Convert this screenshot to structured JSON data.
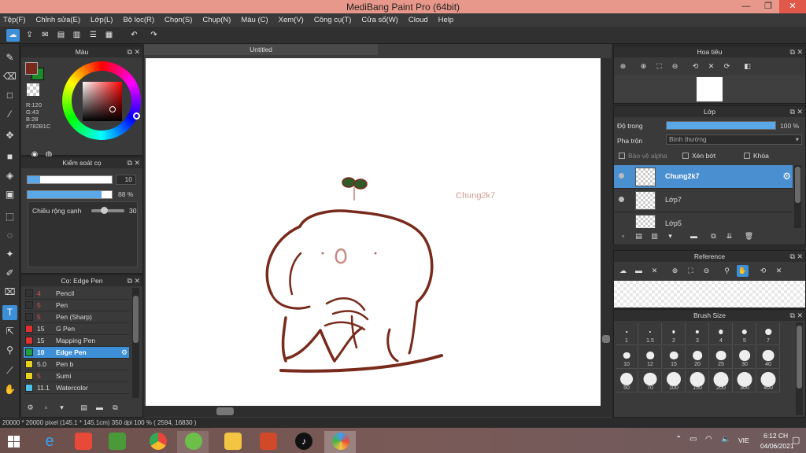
{
  "window": {
    "title": "MediBang Paint Pro (64bit)"
  },
  "menu": [
    "Tệp(F)",
    "Chỉnh sửa(E)",
    "Lớp(L)",
    "Bộ lọc(R)",
    "Chọn(S)",
    "Chụp(N)",
    "Màu (C)",
    "Xem(V)",
    "Công cụ(T)",
    "Cửa sổ(W)",
    "Cloud",
    "Help"
  ],
  "color_panel": {
    "title": "Màu",
    "r": "R:120",
    "g": "G:43",
    "b": "B:28",
    "hex": "#782B1C",
    "main_color": "#782b1c",
    "sub_color": "#1c8a2a"
  },
  "brush_control": {
    "title": "Kiểm soát cọ",
    "size_value": "10",
    "size_fraction": 0.15,
    "opacity_value": "88 %",
    "opacity_fraction": 0.88,
    "width_label": "Chiều rộng cạnh",
    "width_value": "30"
  },
  "brush_list": {
    "title": "Cọ: Edge Pen",
    "items": [
      {
        "size": "4",
        "name": "Pencil",
        "color": "#333333",
        "size_color": "#e05050"
      },
      {
        "size": "5",
        "name": "Pen",
        "color": "#333333",
        "size_color": "#e05050"
      },
      {
        "size": "5",
        "name": "Pen (Sharp)",
        "color": "#333333",
        "size_color": "#e05050"
      },
      {
        "size": "15",
        "name": "G Pen",
        "color": "#e03030",
        "size_color": "#dddddd"
      },
      {
        "size": "15",
        "name": "Mapping Pen",
        "color": "#e03030",
        "size_color": "#dddddd"
      },
      {
        "size": "10",
        "name": "Edge Pen",
        "color": "#20a040",
        "size_color": "#ffffff",
        "selected": true
      },
      {
        "size": "5.0",
        "name": "Pen b",
        "color": "#e8d020",
        "size_color": "#dddddd"
      },
      {
        "size": "5",
        "name": "Sumi",
        "color": "#e8d020",
        "size_color": "#e05050"
      },
      {
        "size": "11.1",
        "name": "Watercolor",
        "color": "#50c0e8",
        "size_color": "#dddddd"
      }
    ]
  },
  "document": {
    "tab_title": "Untitled",
    "signature": "Chung2k7"
  },
  "status": {
    "text": "20000 * 20000 pixel  (145.1 * 145.1cm)  350 dpi  100 %  ( 2594, 16830 )"
  },
  "navigator": {
    "title": "Hoa tiêu"
  },
  "layer_panel": {
    "title": "Lớp",
    "opacity_label": "Độ trong",
    "opacity_value": "100 %",
    "opacity_fraction": 1.0,
    "blend_label": "Pha trộn",
    "blend_value": "Bình thường",
    "protect_alpha": "Bảo vệ alpha",
    "clipping": "Xén bớt",
    "lock": "Khóa",
    "layers": [
      {
        "name": "Chung2k7",
        "selected": true
      },
      {
        "name": "Lớp7",
        "selected": false
      },
      {
        "name": "Lớp5",
        "selected": false
      }
    ]
  },
  "reference": {
    "title": "Reference"
  },
  "brush_size": {
    "title": "Brush Size",
    "sizes": [
      "1",
      "1.5",
      "2",
      "3",
      "4",
      "5",
      "7",
      "10",
      "12",
      "15",
      "20",
      "25",
      "30",
      "40",
      "50",
      "70",
      "100",
      "150",
      "200",
      "300",
      "400"
    ]
  },
  "taskbar": {
    "lang": "VIE",
    "time": "6:12 CH",
    "date": "04/06/2021"
  }
}
